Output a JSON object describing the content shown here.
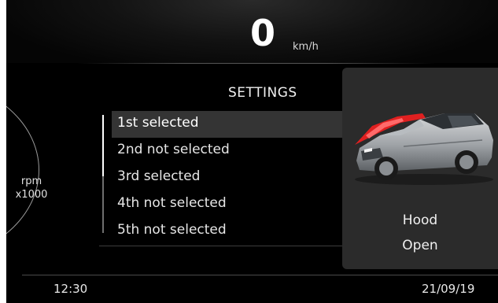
{
  "speed": {
    "value": "0",
    "unit": "km/h"
  },
  "tachometer": {
    "label_line1": "rpm",
    "label_line2": "x1000"
  },
  "settings": {
    "title": "SETTINGS",
    "items": [
      {
        "label": "1st selected",
        "selected": true
      },
      {
        "label": "2nd not selected",
        "selected": false
      },
      {
        "label": "3rd selected",
        "selected": false
      },
      {
        "label": "4th not selected",
        "selected": false
      },
      {
        "label": "5th not selected",
        "selected": false
      }
    ],
    "scroll_position": 0.52
  },
  "vehicle_status": {
    "part": "Hood",
    "state": "Open",
    "highlight_color": "#e02020"
  },
  "status_bar": {
    "time": "12:30",
    "date": "21/09/19"
  },
  "colors": {
    "background": "#000000",
    "card": "#2b2b2b",
    "selected_row": "#343434",
    "text": "#ffffff"
  }
}
